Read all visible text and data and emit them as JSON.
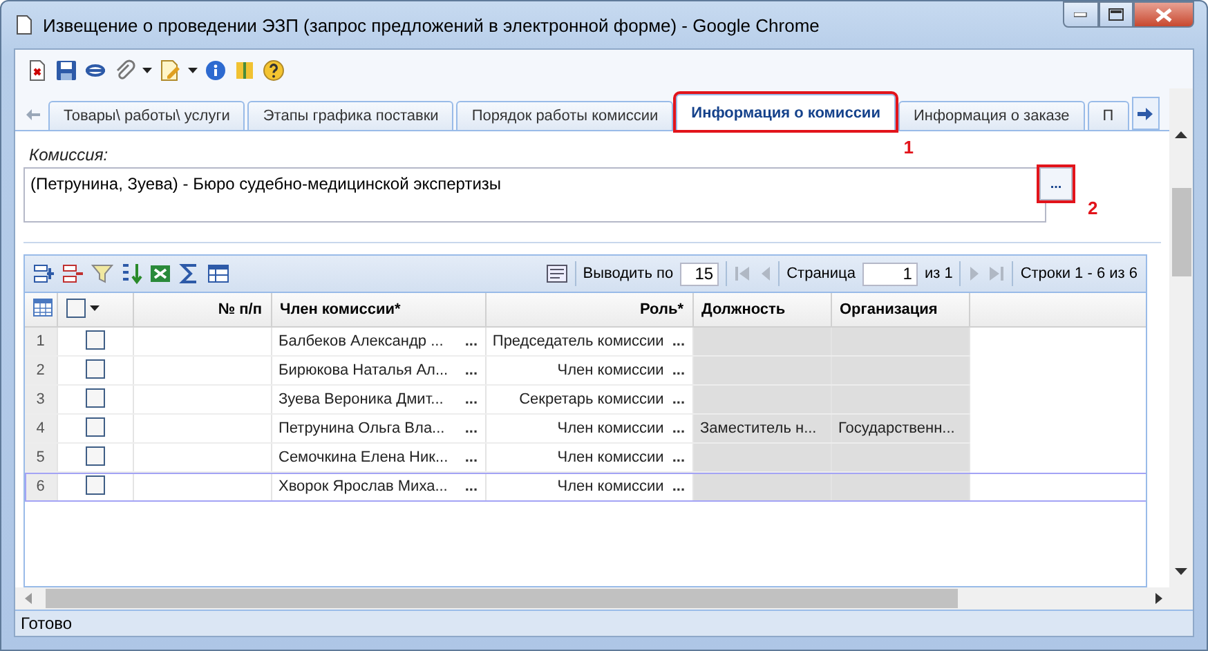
{
  "window": {
    "title": "Извещение о проведении ЭЗП (запрос предложений в электронной форме) - Google Chrome"
  },
  "tabs": [
    {
      "label": "Товары\\ работы\\ услуги",
      "selected": false
    },
    {
      "label": "Этапы графика поставки",
      "selected": false
    },
    {
      "label": "Порядок работы комиссии",
      "selected": false
    },
    {
      "label": "Информация о комиссии",
      "selected": true,
      "callout": "1"
    },
    {
      "label": "Информация о заказе",
      "selected": false
    },
    {
      "label": "П",
      "selected": false
    }
  ],
  "commission": {
    "label": "Комиссия:",
    "value": "(Петрунина, Зуева) - Бюро судебно-медицинской экспертизы",
    "picker": "...",
    "callout": "2"
  },
  "pager": {
    "page_size_label": "Выводить по",
    "page_size": "15",
    "page_label": "Страница",
    "page": "1",
    "page_count": "из 1",
    "rows_info": "Строки 1 - 6 из 6"
  },
  "table": {
    "all_checked": false,
    "columns": [
      {
        "label": "№ п/п",
        "readonly": false
      },
      {
        "label": "Член комиссии*",
        "readonly": false
      },
      {
        "label": "Роль*",
        "readonly": false
      },
      {
        "label": "Должность",
        "readonly": true
      },
      {
        "label": "Организация",
        "readonly": true
      }
    ],
    "rows": [
      {
        "number": "1",
        "checked": false,
        "selected": false,
        "cells": [
          "",
          "Балбеков Александр ...",
          "Председатель комиссии",
          "",
          ""
        ]
      },
      {
        "number": "2",
        "checked": false,
        "selected": false,
        "cells": [
          "",
          "Бирюкова Наталья Ал...",
          "Член комиссии",
          "",
          ""
        ]
      },
      {
        "number": "3",
        "checked": false,
        "selected": false,
        "cells": [
          "",
          "Зуева Вероника Дмит...",
          "Секретарь комиссии",
          "",
          ""
        ]
      },
      {
        "number": "4",
        "checked": false,
        "selected": false,
        "cells": [
          "",
          "Петрунина Ольга Вла...",
          "Член комиссии",
          "Заместитель н...",
          "Государственн..."
        ]
      },
      {
        "number": "5",
        "checked": false,
        "selected": false,
        "cells": [
          "",
          "Семочкина Елена Ник...",
          "Член комиссии",
          "",
          ""
        ]
      },
      {
        "number": "6",
        "checked": false,
        "selected": true,
        "cells": [
          "",
          "Хворок Ярослав Миха...",
          "Член комиссии",
          "",
          ""
        ]
      }
    ],
    "cell_picker": "..."
  },
  "status_bar": "Готово"
}
